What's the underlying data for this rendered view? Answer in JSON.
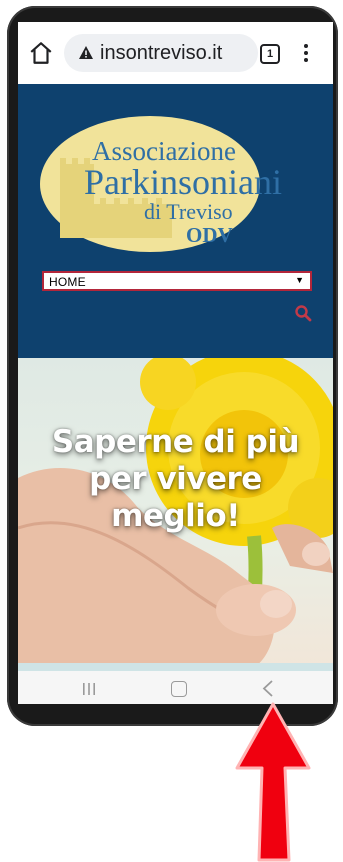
{
  "browser": {
    "url": "insontreviso.it",
    "tab_count": "1"
  },
  "header": {
    "logo_line1": "Associazione",
    "logo_line2": "Parkinsoniani",
    "logo_line3": "di Treviso",
    "logo_line4": "ODV",
    "nav_selected": "HOME"
  },
  "hero": {
    "line1": "Saperne di più",
    "line2": "per vivere",
    "line3": "meglio!"
  },
  "icons": {
    "home": "home-icon",
    "lock": "lock-icon",
    "tabs": "tabs-icon",
    "menu": "more-vert-icon",
    "search": "search-icon",
    "recent": "recent-apps-icon",
    "nav_home": "nav-home-icon",
    "back": "back-icon",
    "arrow": "red-arrow-icon"
  },
  "colors": {
    "header_bg": "#0e416e",
    "logo_oval": "#f1e39a",
    "logo_text": "#2f6fa5",
    "accent_red": "#b3263a",
    "arrow_red": "#f0000f"
  }
}
